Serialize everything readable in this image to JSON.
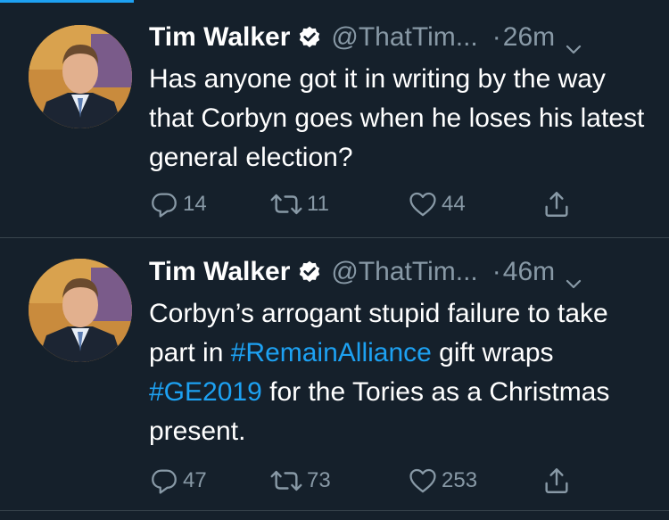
{
  "colors": {
    "background": "#15202b",
    "accent": "#1da1f2",
    "muted": "#8899a6",
    "divider": "#38444d"
  },
  "tweets": [
    {
      "display_name": "Tim Walker",
      "handle": "@ThatTim...",
      "separator": "·",
      "time": "26m",
      "text_parts": [
        {
          "text": "Has anyone got it in writing by the way that Corbyn goes when he loses his latest general election?"
        }
      ],
      "replies": "14",
      "retweets": "11",
      "likes": "44",
      "icons": [
        "verified-icon",
        "chevron-down-icon",
        "reply-icon",
        "retweet-icon",
        "heart-icon",
        "share-icon"
      ]
    },
    {
      "display_name": "Tim Walker",
      "handle": "@ThatTim...",
      "separator": "·",
      "time": "46m",
      "text_parts": [
        {
          "text": "Corbyn’s arrogant stupid failure to take part in "
        },
        {
          "text": "#RemainAlliance",
          "hashtag": true
        },
        {
          "text": " gift wraps "
        },
        {
          "text": "#GE2019",
          "hashtag": true
        },
        {
          "text": " for the Tories as a Christmas present."
        }
      ],
      "replies": "47",
      "retweets": "73",
      "likes": "253",
      "icons": [
        "verified-icon",
        "chevron-down-icon",
        "reply-icon",
        "retweet-icon",
        "heart-icon",
        "share-icon"
      ]
    }
  ]
}
